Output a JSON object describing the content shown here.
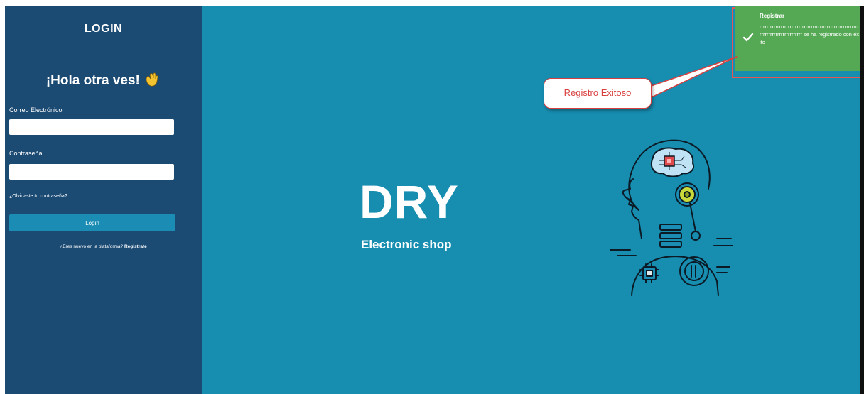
{
  "sidebar": {
    "title": "LOGIN",
    "greeting": "¡Hola otra ves!",
    "email_label": "Correo Electrónico",
    "email_value": "",
    "password_label": "Contraseña",
    "password_value": "",
    "forgot_link": "¿Olvidaste tu contraseña?",
    "login_button": "Login",
    "register_prompt": "¿Eres nuevo en la plataforma?",
    "register_link": "Registrate"
  },
  "main": {
    "brand": "DRY",
    "tagline": "Electronic shop"
  },
  "toast": {
    "title": "Registrar",
    "message": "rrrrrrrrrrrrrrrrrrrrrrrrrrrrrrrrrrrrrrrrrrrrrrrrrrrrrrrrrrrrrrrrrrrrrrrrrrrrrrrr se ha registrado con éxito"
  },
  "callout": {
    "text": "Registro Exitoso"
  },
  "colors": {
    "sidebar_bg": "#1b4a73",
    "main_bg": "#178db0",
    "button_bg": "#1b8cb4",
    "toast_bg": "#55a954",
    "callout_text": "#d94040"
  },
  "icons": [
    "waving-hand-icon",
    "check-icon",
    "robot-head-illustration"
  ]
}
